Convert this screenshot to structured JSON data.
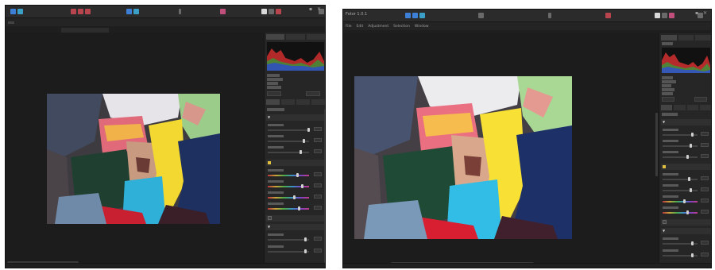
{
  "left": {
    "menu": []
  },
  "right": {
    "window_title": "Fotor 1.0.1",
    "menu": [
      "File",
      "Edit",
      "Adjustment",
      "Selection",
      "Window"
    ]
  },
  "colors": {
    "app_background": "#1e1e1e",
    "panel_background": "#262626",
    "toolbar_accent_blue": "#3d7fd6",
    "toolbar_accent_red": "#b8444e"
  },
  "icons": [
    "hand-tool-icon",
    "crop-tool-icon",
    "brush-tool-icon",
    "compare-icon",
    "share-icon",
    "minimize-icon",
    "close-icon"
  ]
}
